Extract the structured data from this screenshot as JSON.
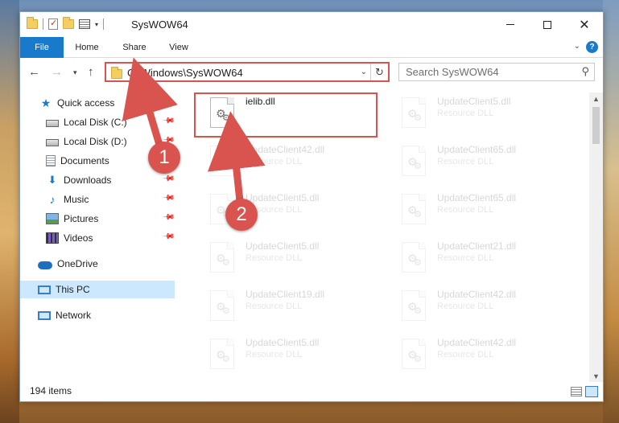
{
  "window": {
    "title": "SysWOW64",
    "controls": [
      "minimize",
      "maximize",
      "close"
    ]
  },
  "ribbon": {
    "tabs": [
      {
        "label": "File",
        "active": true
      },
      {
        "label": "Home"
      },
      {
        "label": "Share"
      },
      {
        "label": "View"
      }
    ]
  },
  "navbar": {
    "address": "C:\\Windows\\SysWOW64",
    "search_placeholder": "Search SysWOW64"
  },
  "sidebar": {
    "items": [
      {
        "label": "Quick access",
        "icon": "star-icon"
      },
      {
        "label": "Local Disk (C:)",
        "icon": "disk-icon",
        "pinned": true
      },
      {
        "label": "Local Disk (D:)",
        "icon": "disk-icon",
        "pinned": true
      },
      {
        "label": "Documents",
        "icon": "documents-icon",
        "pinned": true
      },
      {
        "label": "Downloads",
        "icon": "download-icon",
        "pinned": true
      },
      {
        "label": "Music",
        "icon": "music-icon",
        "pinned": true
      },
      {
        "label": "Pictures",
        "icon": "pictures-icon",
        "pinned": true
      },
      {
        "label": "Videos",
        "icon": "videos-icon",
        "pinned": true
      },
      {
        "label": "OneDrive",
        "icon": "cloud-icon"
      },
      {
        "label": "This PC",
        "icon": "computer-icon",
        "selected": true
      },
      {
        "label": "Network",
        "icon": "network-icon"
      }
    ]
  },
  "files": {
    "left_column": [
      {
        "name": "ielib.dll",
        "type": ""
      },
      {
        "name": "UpdateClient42.dll",
        "type": "Resource DLL"
      },
      {
        "name": "UpdateClient5.dll",
        "type": "Resource DLL"
      },
      {
        "name": "UpdateClient5.dll",
        "type": "Resource DLL"
      },
      {
        "name": "UpdateClient19.dll",
        "type": "Resource DLL"
      },
      {
        "name": "UpdateClient5.dll",
        "type": "Resource DLL"
      }
    ],
    "right_column": [
      {
        "name": "UpdateClient5.dll",
        "type": "Resource DLL"
      },
      {
        "name": "UpdateClient65.dll",
        "type": "Resource DLL"
      },
      {
        "name": "UpdateClient65.dll",
        "type": "Resource DLL"
      },
      {
        "name": "UpdateClient21.dll",
        "type": "Resource DLL"
      },
      {
        "name": "UpdateClient42.dll",
        "type": "Resource DLL"
      },
      {
        "name": "UpdateClient42.dll",
        "type": "Resource DLL"
      }
    ]
  },
  "status": {
    "item_count": "194 items"
  },
  "annotations": {
    "marker_1": "1",
    "marker_2": "2",
    "color": "#d9534f"
  },
  "colors": {
    "accent": "#1979ca",
    "selection": "#cce8ff",
    "highlight": "#d9534f"
  }
}
